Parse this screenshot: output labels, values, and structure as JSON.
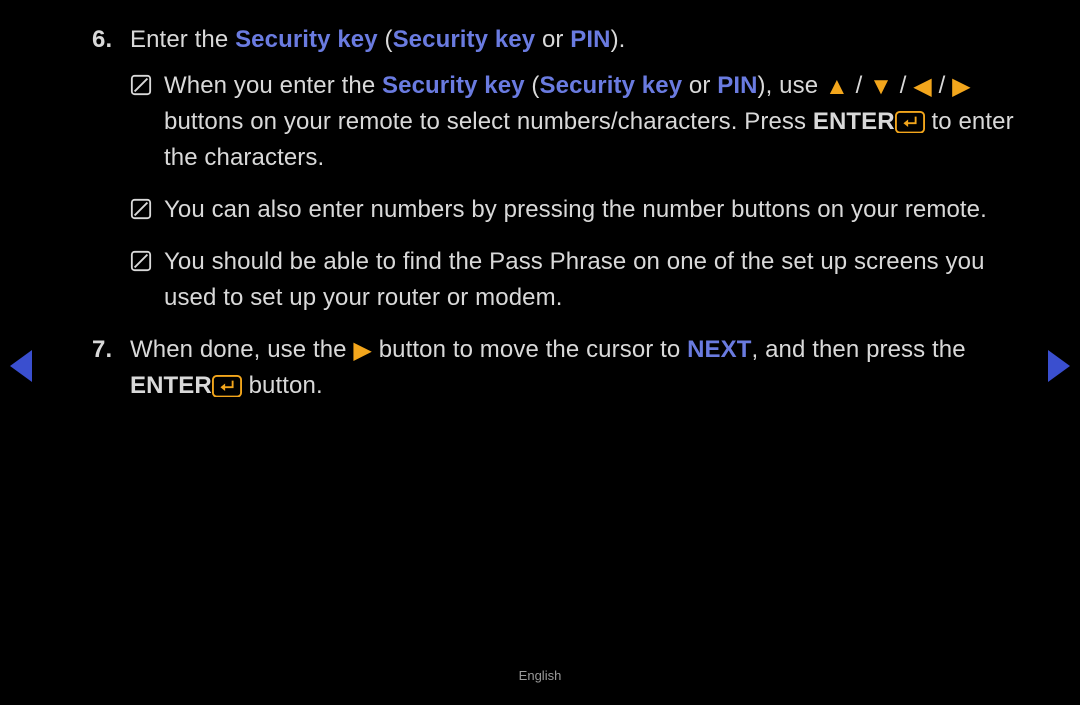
{
  "steps": [
    {
      "num": "6.",
      "parts": {
        "a": "Enter the ",
        "b": "Security key",
        "c": " (",
        "d": "Security key",
        "e": " or ",
        "f": "PIN",
        "g": ")."
      },
      "notes": [
        {
          "a": "When you enter the ",
          "b": "Security key",
          "c": " (",
          "d": "Security key",
          "e": " or ",
          "f": "PIN",
          "g": "), use ",
          "sep": " / ",
          "h": " buttons on your remote to select numbers/characters. Press ",
          "i": "ENTER",
          "j": " to enter the characters."
        },
        {
          "text": "You can also enter numbers by pressing the number buttons on your remote."
        },
        {
          "text": "You should be able to find the Pass Phrase on one of the set up screens you used to set up your router or modem."
        }
      ]
    },
    {
      "num": "7.",
      "parts": {
        "a": "When done, use the ",
        "b": " button to move the cursor to ",
        "c": "NEXT",
        "d": ", and then press the ",
        "e": "ENTER",
        "f": " button."
      }
    }
  ],
  "footer": "English"
}
